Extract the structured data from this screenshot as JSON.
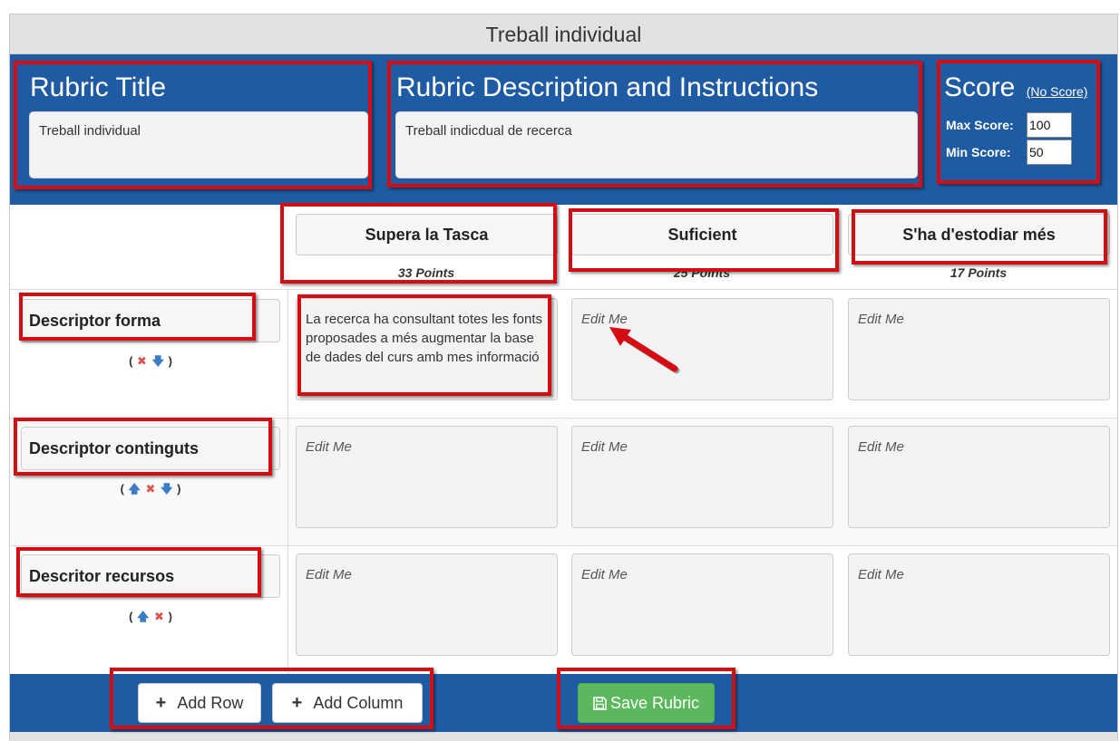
{
  "window": {
    "title": "Treball individual"
  },
  "header": {
    "rubric_title_heading": "Rubric Title",
    "rubric_title_value": "Treball individual",
    "description_heading": "Rubric Description and Instructions",
    "description_value": "Treball indicdual de recerca",
    "score_heading": "Score",
    "no_score_link": "(No Score)",
    "max_score_label": "Max Score:",
    "max_score_value": "100",
    "min_score_label": "Min Score:",
    "min_score_value": "50"
  },
  "columns": [
    {
      "label": "Supera la Tasca",
      "points": "33 Points"
    },
    {
      "label": "Suficient",
      "points": "25 Points"
    },
    {
      "label": "S'ha d'estodiar més",
      "points": "17 Points"
    }
  ],
  "rows": [
    {
      "label": "Descriptor forma",
      "cells": [
        "La recerca ha consultant totes les fonts proposades a més augmentar la base de dades del curs amb mes informació",
        "Edit Me",
        "Edit Me"
      ]
    },
    {
      "label": "Descriptor continguts",
      "cells": [
        "Edit Me",
        "Edit Me",
        "Edit Me"
      ]
    },
    {
      "label": "Descritor recursos",
      "cells": [
        "Edit Me",
        "Edit Me",
        "Edit Me"
      ]
    }
  ],
  "controls": {
    "open": "(",
    "close": ")",
    "delete_glyph": "✖",
    "up_glyph": "🡅",
    "down_glyph": "🡇"
  },
  "footer": {
    "add_row_label": "Add Row",
    "add_column_label": "Add Column",
    "save_label": "Save Rubric",
    "plus_glyph": "+"
  },
  "colors": {
    "header_bg": "#1f5ba3",
    "highlight": "#d40d12",
    "save_green": "#5cb85c"
  }
}
